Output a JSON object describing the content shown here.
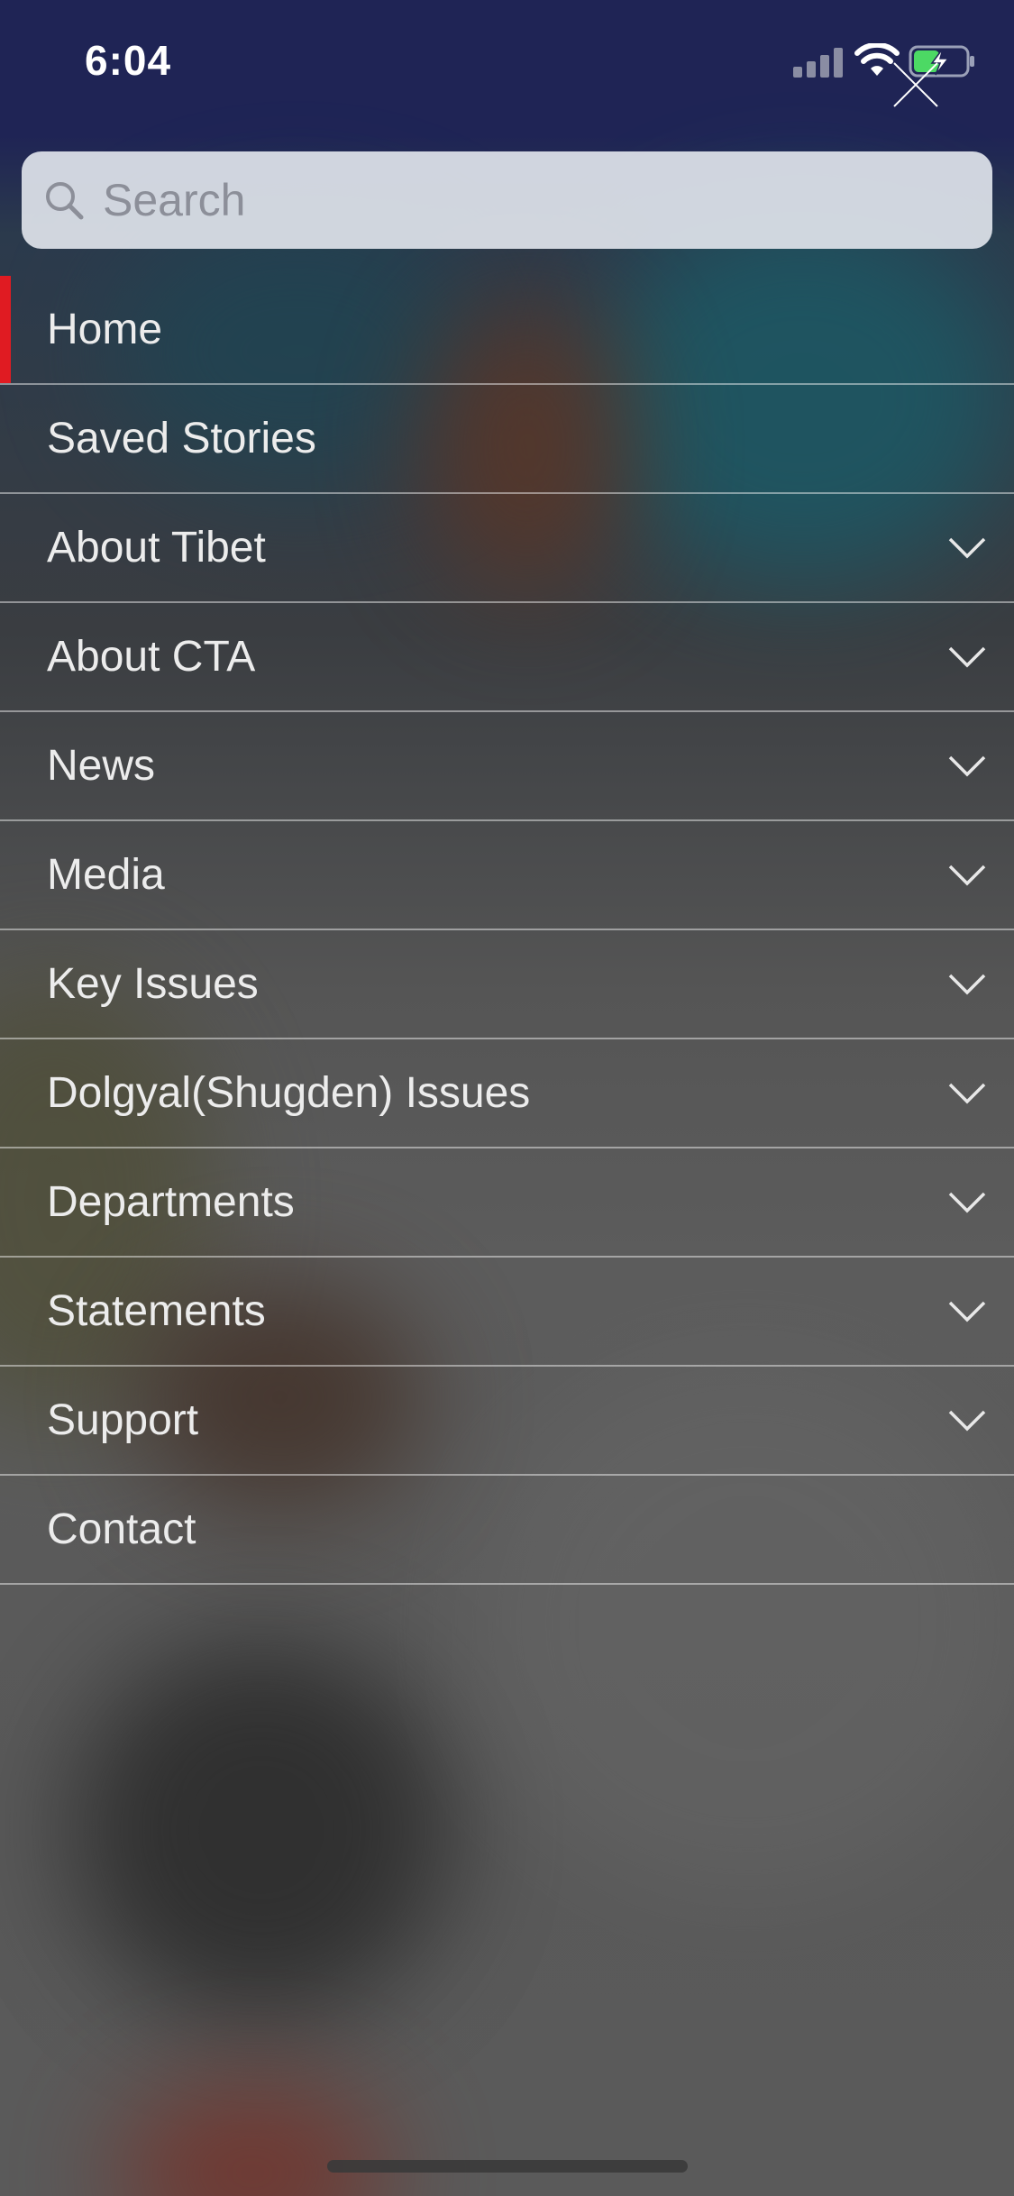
{
  "status_bar": {
    "time": "6:04",
    "signal_icon": "cellular-signal-icon",
    "wifi_icon": "wifi-icon",
    "battery_icon": "battery-charging-icon",
    "battery_color": "#4cd964"
  },
  "close_icon": "close-icon",
  "search": {
    "placeholder": "Search",
    "value": "",
    "icon": "search-icon"
  },
  "menu": {
    "accent_color": "#e01b22",
    "items": [
      {
        "label": "Home",
        "active": true,
        "expandable": false
      },
      {
        "label": "Saved Stories",
        "active": false,
        "expandable": false
      },
      {
        "label": "About Tibet",
        "active": false,
        "expandable": true
      },
      {
        "label": "About CTA",
        "active": false,
        "expandable": true
      },
      {
        "label": "News",
        "active": false,
        "expandable": true
      },
      {
        "label": "Media",
        "active": false,
        "expandable": true
      },
      {
        "label": "Key Issues",
        "active": false,
        "expandable": true
      },
      {
        "label": "Dolgyal(Shugden) Issues",
        "active": false,
        "expandable": true
      },
      {
        "label": "Departments",
        "active": false,
        "expandable": true
      },
      {
        "label": "Statements",
        "active": false,
        "expandable": true
      },
      {
        "label": "Support",
        "active": false,
        "expandable": true
      },
      {
        "label": "Contact",
        "active": false,
        "expandable": false
      }
    ]
  }
}
